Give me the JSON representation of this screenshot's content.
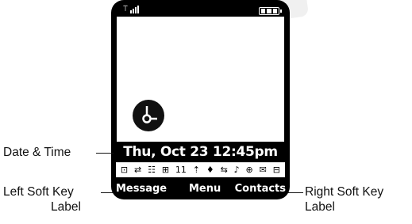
{
  "phone": {
    "date_time": "Thu, Oct 23 12:45pm",
    "softkeys": {
      "left": "Message",
      "menu": "Menu",
      "right": "Contacts"
    },
    "indicators": [
      "⊡",
      "⇄",
      "☷",
      "⊞",
      "11",
      "⇡",
      "♦",
      "⇆",
      "♪",
      "⊕",
      "✉",
      "⊟"
    ],
    "signal_icon": "signal-strength-icon",
    "battery_icon": "battery-icon",
    "clock_icon": "clock-icon"
  },
  "labels": {
    "date_time": "Date & Time",
    "left_soft_key_line1": "Left Soft Key",
    "left_soft_key_line2": "Label",
    "right_soft_key_line1": "Right Soft Key",
    "right_soft_key_line2": "Label"
  }
}
